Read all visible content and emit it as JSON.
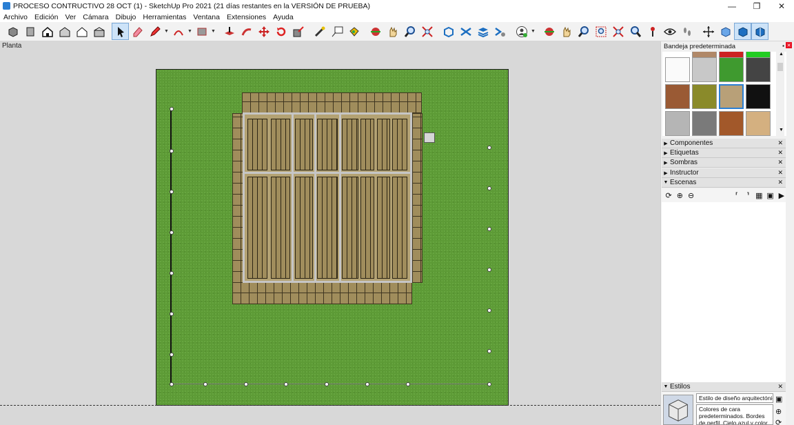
{
  "window": {
    "title": "PROCESO CONTRUCTIVO 28 OCT (1) - SketchUp Pro 2021 (21 días restantes en la VERSIÓN DE PRUEBA)",
    "minimize": "—",
    "maximize": "❐",
    "close": "✕"
  },
  "menu": [
    "Archivo",
    "Edición",
    "Ver",
    "Cámara",
    "Dibujo",
    "Herramientas",
    "Ventana",
    "Extensiones",
    "Ayuda"
  ],
  "viewport": {
    "scene_label": "Planta"
  },
  "tray": {
    "title": "Bandeja predeterminada",
    "panels": [
      {
        "label": "Componentes",
        "expanded": false
      },
      {
        "label": "Etiquetas",
        "expanded": false
      },
      {
        "label": "Sombras",
        "expanded": false
      },
      {
        "label": "Instructor",
        "expanded": false
      },
      {
        "label": "Escenas",
        "expanded": true
      }
    ],
    "styles": {
      "label": "Estilos",
      "style_name": "Estilo de diseño arquitectónico",
      "description": "Colores de cara predeterminados. Bordes de perfil. Cielo azul y color de"
    }
  },
  "colors": {
    "ground": "#5d9b36",
    "wood": "#a08d5c",
    "frame": "#c6c6c6",
    "accent": "#2a7fd4"
  }
}
